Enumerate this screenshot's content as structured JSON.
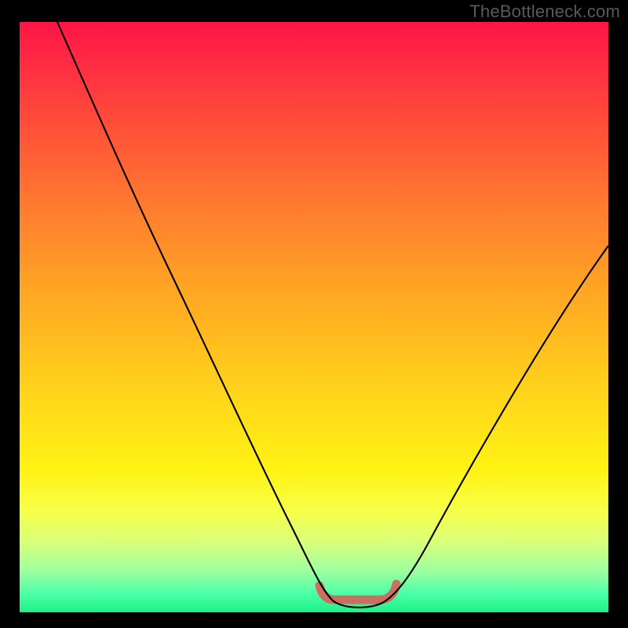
{
  "watermark": "TheBottleneck.com",
  "colors": {
    "background": "#000000",
    "watermark": "#5a5a5a",
    "curve": "#000000",
    "marker": "#d6635b"
  },
  "chart_data": {
    "type": "line",
    "title": "",
    "xlabel": "",
    "ylabel": "",
    "xlim": [
      0,
      100
    ],
    "ylim": [
      0,
      100
    ],
    "series": [
      {
        "name": "bottleneck-curve",
        "x": [
          0,
          5,
          10,
          15,
          20,
          25,
          30,
          35,
          40,
          45,
          50,
          53,
          56,
          59,
          62,
          65,
          70,
          75,
          80,
          85,
          90,
          95,
          100
        ],
        "y": [
          100,
          92,
          83,
          74,
          65,
          56,
          47,
          38,
          29,
          20,
          11,
          4,
          1,
          1,
          3,
          7,
          15,
          24,
          33,
          41,
          48,
          55,
          62
        ]
      }
    ],
    "annotations": [
      {
        "name": "optimal-range-marker",
        "x_start": 53,
        "x_end": 62,
        "y": 1
      }
    ]
  }
}
